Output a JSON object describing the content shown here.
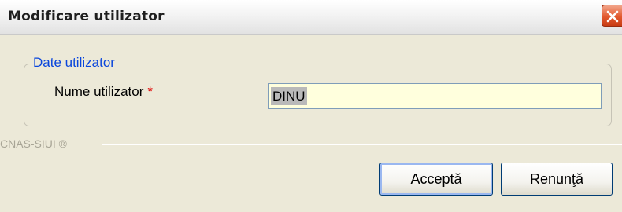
{
  "window": {
    "title": "Modificare utilizator"
  },
  "group": {
    "legend": "Date utilizator",
    "field_label": "Nume utilizator",
    "required_mark": "*",
    "username_value": "DINU"
  },
  "footer": {
    "label": "CNAS-SIUI ®"
  },
  "buttons": {
    "accept_label": "Acceptă",
    "cancel_label": "Renunţă"
  },
  "icons": {
    "close": "close-icon"
  },
  "colors": {
    "legend_blue": "#0a46dc",
    "required_red": "#e00000",
    "input_background": "#ffffdd",
    "close_button": "#e2592e"
  }
}
